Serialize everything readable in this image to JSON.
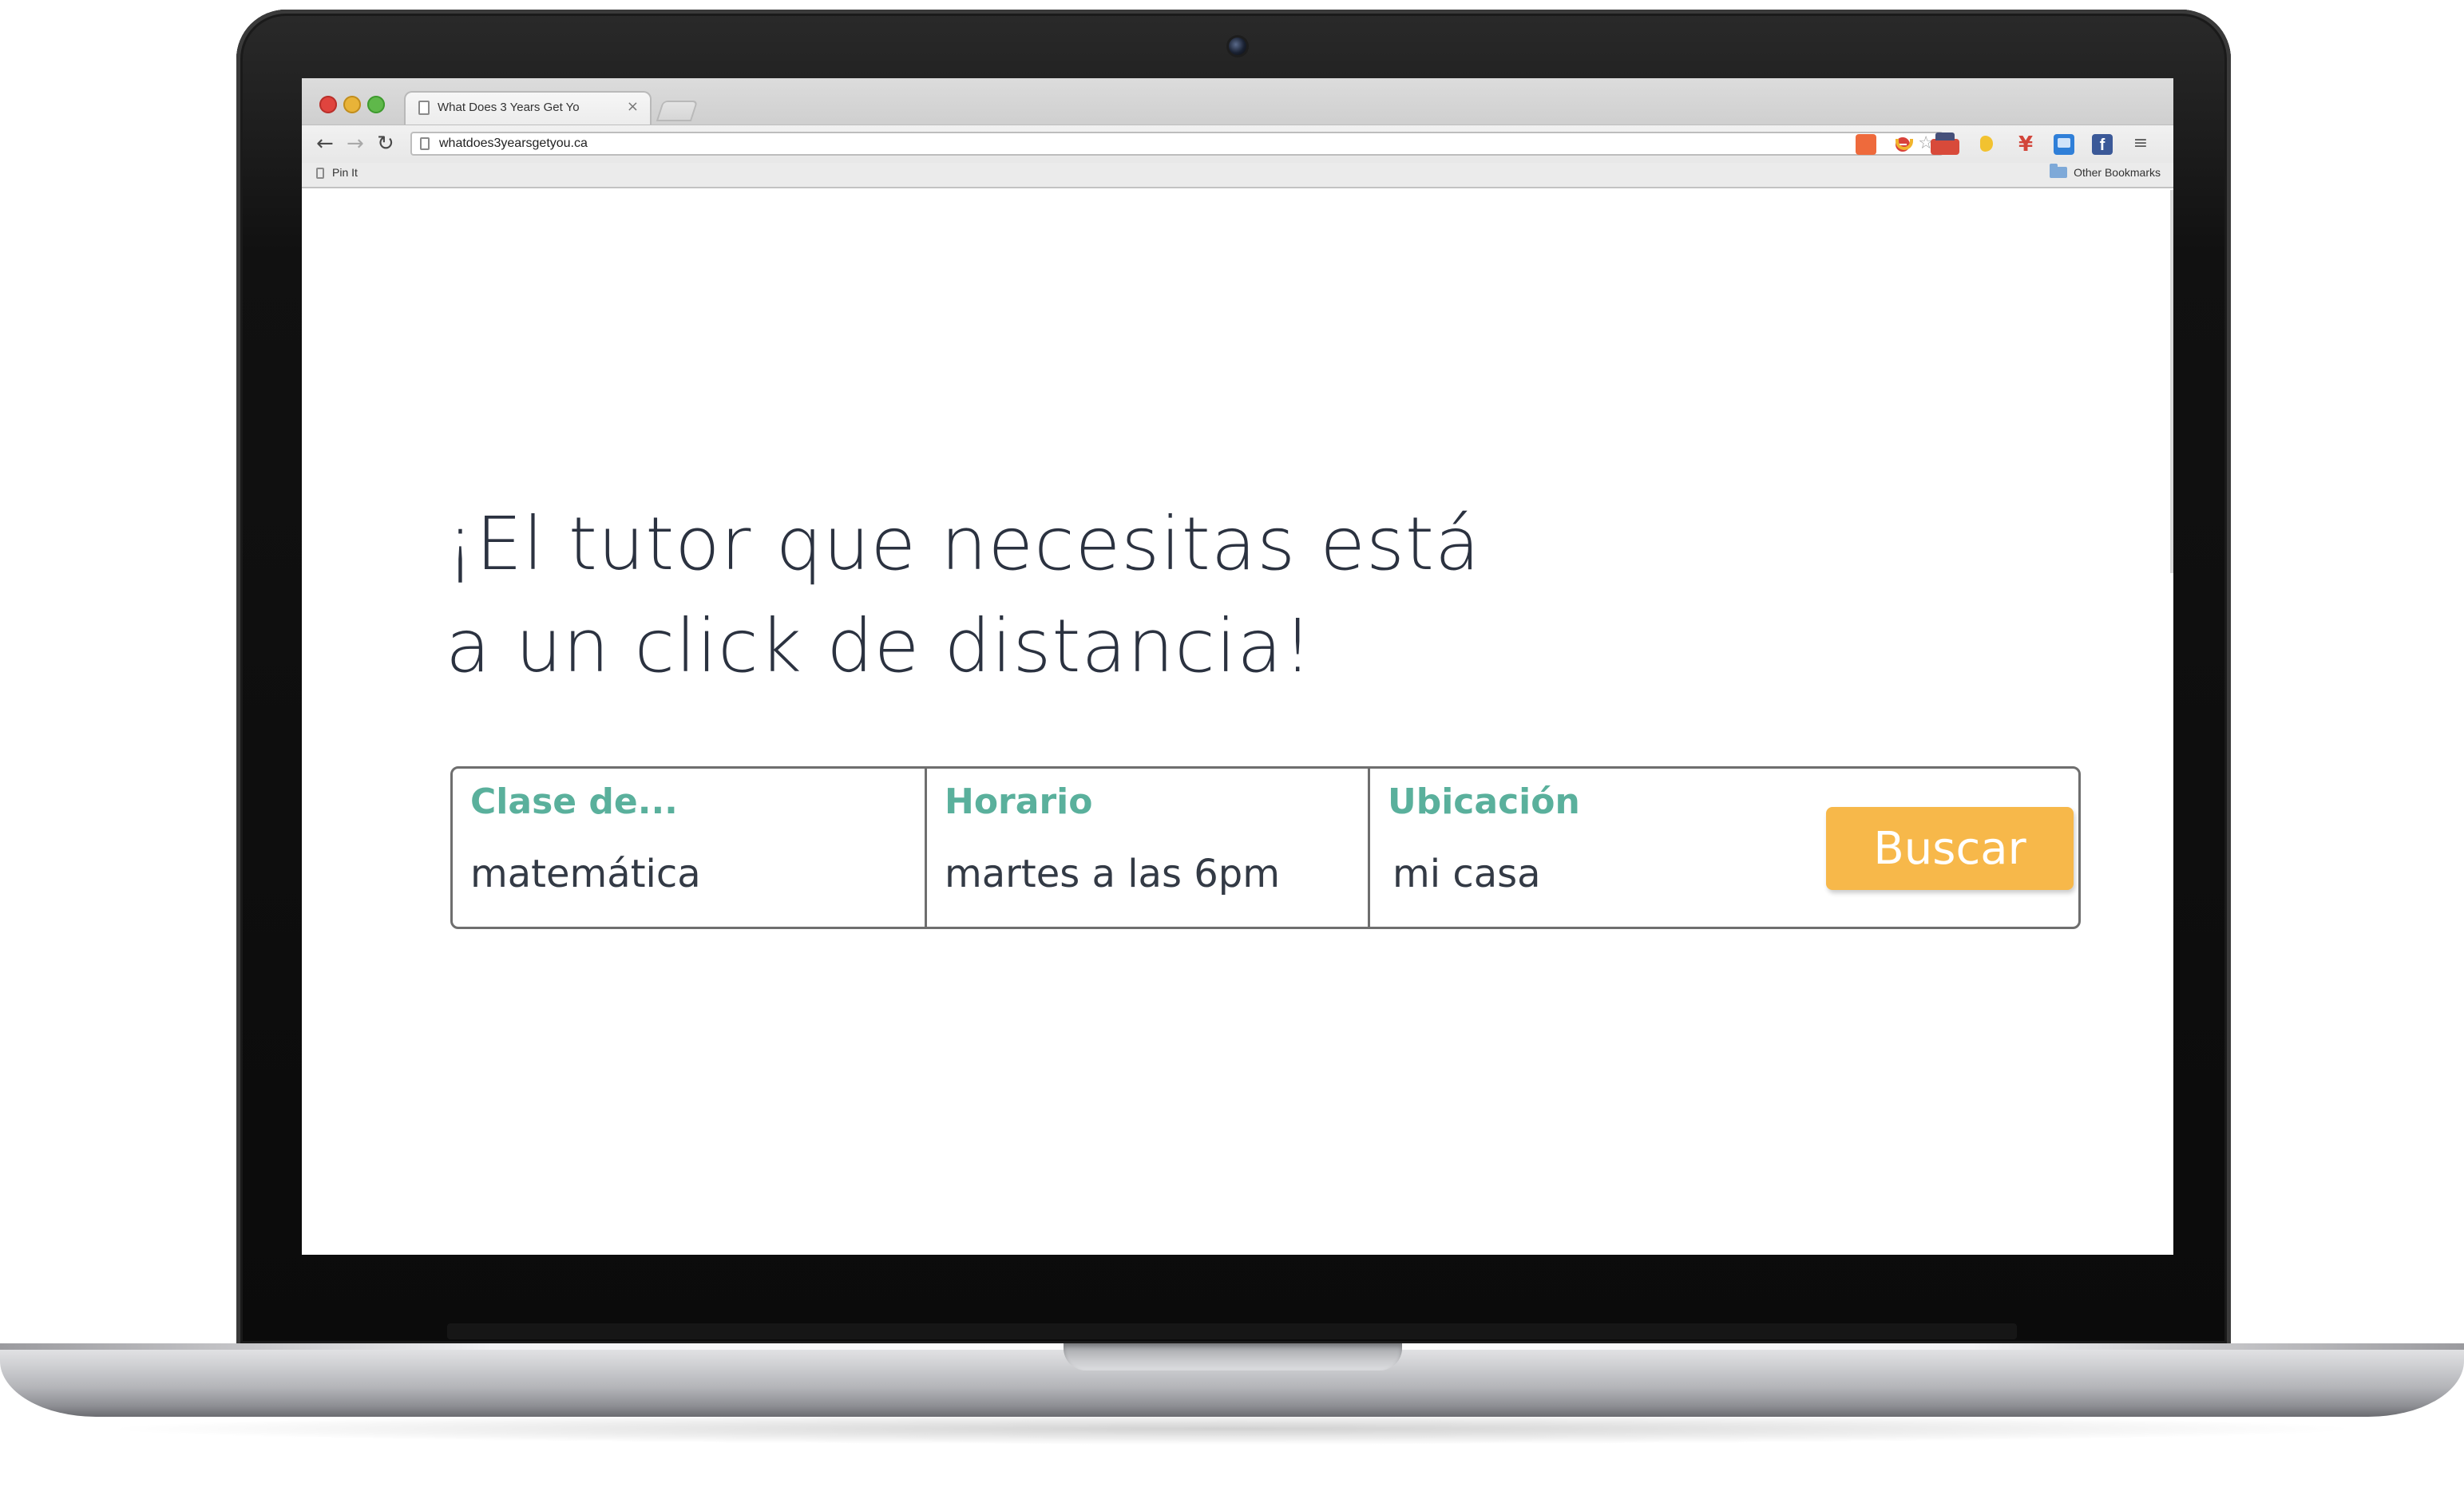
{
  "browser": {
    "tab_title": "What Does 3 Years Get Yo",
    "tab_close": "×",
    "url": "whatdoes3yearsgetyou.ca",
    "bookmarks": {
      "item": "Pin It",
      "other": "Other Bookmarks"
    },
    "extensions": [
      "stop-icon",
      "star-icon",
      "addon-orange-icon",
      "addon-horseshoe-icon",
      "addon-new-badge-icon",
      "addon-yellow-icon",
      "addon-y-icon",
      "addon-blue-icon",
      "facebook-icon",
      "menu-icon"
    ]
  },
  "page": {
    "headline": {
      "line1": "¡El tutor que necesitas está",
      "line2": "a un click de distancia!"
    },
    "search": {
      "fields": [
        {
          "label": "Clase de...",
          "value": "matemática"
        },
        {
          "label": "Horario",
          "value": "martes a las 6pm"
        },
        {
          "label": "Ubicación",
          "value": "mi casa"
        }
      ],
      "button_label": "Buscar"
    }
  },
  "colors": {
    "accent_teal": "#5ab09c",
    "button_orange": "#f7b84a",
    "headline_text": "#2b3240"
  }
}
